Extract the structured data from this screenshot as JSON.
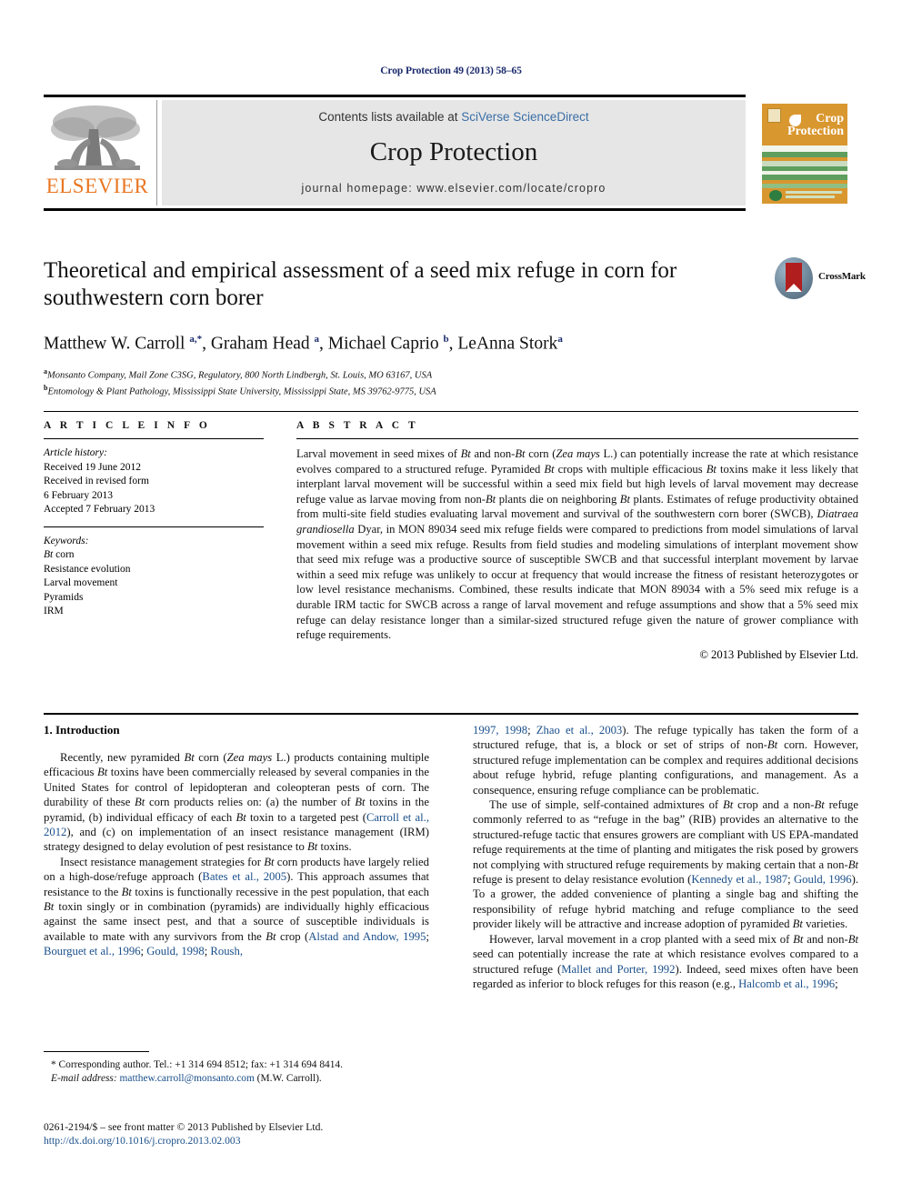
{
  "running_head": "Crop Protection 49 (2013) 58–65",
  "masthead": {
    "contents_prefix": "Contents lists available at ",
    "sciencedirect": "SciVerse ScienceDirect",
    "journal_title": "Crop Protection",
    "homepage": "journal homepage: www.elsevier.com/locate/cropro",
    "publisher_logo_text": "ELSEVIER",
    "cover_title_line1": "Crop",
    "cover_title_line2": "Protection",
    "accent_orange": "#e87722",
    "link_blue": "#3a6ea5",
    "band_grey": "#e6e6e6"
  },
  "article": {
    "title": "Theoretical and empirical assessment of a seed mix refuge in corn for southwestern corn borer",
    "crossmark_label": "CrossMark",
    "authors_html": "Matthew W. Carroll <sup>a,*</sup>, Graham Head <sup>a</sup>, Michael Caprio <sup>b</sup>, LeAnna Stork<sup>a</sup>",
    "affiliations": [
      {
        "marker": "a",
        "text": "Monsanto Company, Mail Zone C3SG, Regulatory, 800 North Lindbergh, St. Louis, MO 63167, USA"
      },
      {
        "marker": "b",
        "text": "Entomology & Plant Pathology, Mississippi State University, Mississippi State, MS 39762-9775, USA"
      }
    ]
  },
  "article_info": {
    "heading": "A R T I C L E   I N F O",
    "history_label": "Article history:",
    "history": [
      "Received 19 June 2012",
      "Received in revised form",
      "6 February 2013",
      "Accepted 7 February 2013"
    ],
    "keywords_label": "Keywords:",
    "keywords_html": [
      "<i>Bt</i> corn",
      "Resistance evolution",
      "Larval movement",
      "Pyramids",
      "IRM"
    ]
  },
  "abstract": {
    "heading": "A B S T R A C T",
    "body_html": "Larval movement in seed mixes of <i>Bt</i> and non-<i>Bt</i> corn (<i>Zea mays</i> L.) can potentially increase the rate at which resistance evolves compared to a structured refuge. Pyramided <i>Bt</i> crops with multiple efficacious <i>Bt</i> toxins make it less likely that interplant larval movement will be successful within a seed mix field but high levels of larval movement may decrease refuge value as larvae moving from non-<i>Bt</i> plants die on neighboring <i>Bt</i> plants. Estimates of refuge productivity obtained from multi-site field studies evaluating larval movement and survival of the southwestern corn borer (SWCB), <i>Diatraea grandiosella</i> Dyar, in MON 89034 seed mix refuge fields were compared to predictions from model simulations of larval movement within a seed mix refuge. Results from field studies and modeling simulations of interplant movement show that seed mix refuge was a productive source of susceptible SWCB and that successful interplant movement by larvae within a seed mix refuge was unlikely to occur at frequency that would increase the fitness of resistant heterozygotes or low level resistance mechanisms. Combined, these results indicate that MON 89034 with a 5% seed mix refuge is a durable IRM tactic for SWCB across a range of larval movement and refuge assumptions and show that a 5% seed mix refuge can delay resistance longer than a similar-sized structured refuge given the nature of grower compliance with refuge requirements.",
    "copyright": "© 2013 Published by Elsevier Ltd."
  },
  "introduction": {
    "section_title": "1.  Introduction",
    "left_paragraphs_html": [
      "Recently, new pyramided <i>Bt</i> corn (<i>Zea mays</i> L.) products containing multiple efficacious <i>Bt</i> toxins have been commercially released by several companies in the United States for control of lepidopteran and coleopteran pests of corn. The durability of these <i>Bt</i> corn products relies on: (a) the number of <i>Bt</i> toxins in the pyramid, (b) individual efficacy of each <i>Bt</i> toxin to a targeted pest (<span class=\"ref\">Carroll et al., 2012</span>), and (c) on implementation of an insect resistance management (IRM) strategy designed to delay evolution of pest resistance to <i>Bt</i> toxins.",
      "Insect resistance management strategies for <i>Bt</i> corn products have largely relied on a high-dose/refuge approach (<span class=\"ref\">Bates et al., 2005</span>). This approach assumes that resistance to the <i>Bt</i> toxins is functionally recessive in the pest population, that each <i>Bt</i> toxin singly or in combination (pyramids) are individually highly efficacious against the same insect pest, and that a source of susceptible individuals is available to mate with any survivors from the <i>Bt</i> crop (<span class=\"ref\">Alstad and Andow, 1995</span>; <span class=\"ref\">Bourguet et al., 1996</span>; <span class=\"ref\">Gould, 1998</span>; <span class=\"ref\">Roush,</span>"
    ],
    "right_paragraphs_html": [
      "<span class=\"ref\">1997, 1998</span>; <span class=\"ref\">Zhao et al., 2003</span>). The refuge typically has taken the form of a structured refuge, that is, a block or set of strips of non-<i>Bt</i> corn. However, structured refuge implementation can be complex and requires additional decisions about refuge hybrid, refuge planting configurations, and management. As a consequence, ensuring refuge compliance can be problematic.",
      "The use of simple, self-contained admixtures of <i>Bt</i> crop and a non-<i>Bt</i> refuge commonly referred to as “refuge in the bag” (RIB) provides an alternative to the structured-refuge tactic that ensures growers are compliant with US EPA-mandated refuge requirements at the time of planting and mitigates the risk posed by growers not complying with structured refuge requirements by making certain that a non-<i>Bt</i> refuge is present to delay resistance evolution (<span class=\"ref\">Kennedy et al., 1987</span>; <span class=\"ref\">Gould, 1996</span>). To a grower, the added convenience of planting a single bag and shifting the responsibility of refuge hybrid matching and refuge compliance to the seed provider likely will be attractive and increase adoption of pyramided <i>Bt</i> varieties.",
      "However, larval movement in a crop planted with a seed mix of <i>Bt</i> and non-<i>Bt</i> seed can potentially increase the rate at which resistance evolves compared to a structured refuge (<span class=\"ref\">Mallet and Porter, 1992</span>). Indeed, seed mixes often have been regarded as inferior to block refuges for this reason (e.g., <span class=\"ref\">Halcomb et al., 1996</span>;"
    ]
  },
  "footnotes": {
    "corresponding_html": "* Corresponding author. Tel.: +1 314 694 8512; fax: +1 314 694 8414.",
    "email_html": "<i>E-mail address:</i> <span class=\"fn-link\">matthew.carroll@monsanto.com</span> (M.W. Carroll)."
  },
  "imprint": {
    "line1": "0261-2194/$ – see front matter © 2013 Published by Elsevier Ltd.",
    "doi": "http://dx.doi.org/10.1016/j.cropro.2013.02.003"
  }
}
